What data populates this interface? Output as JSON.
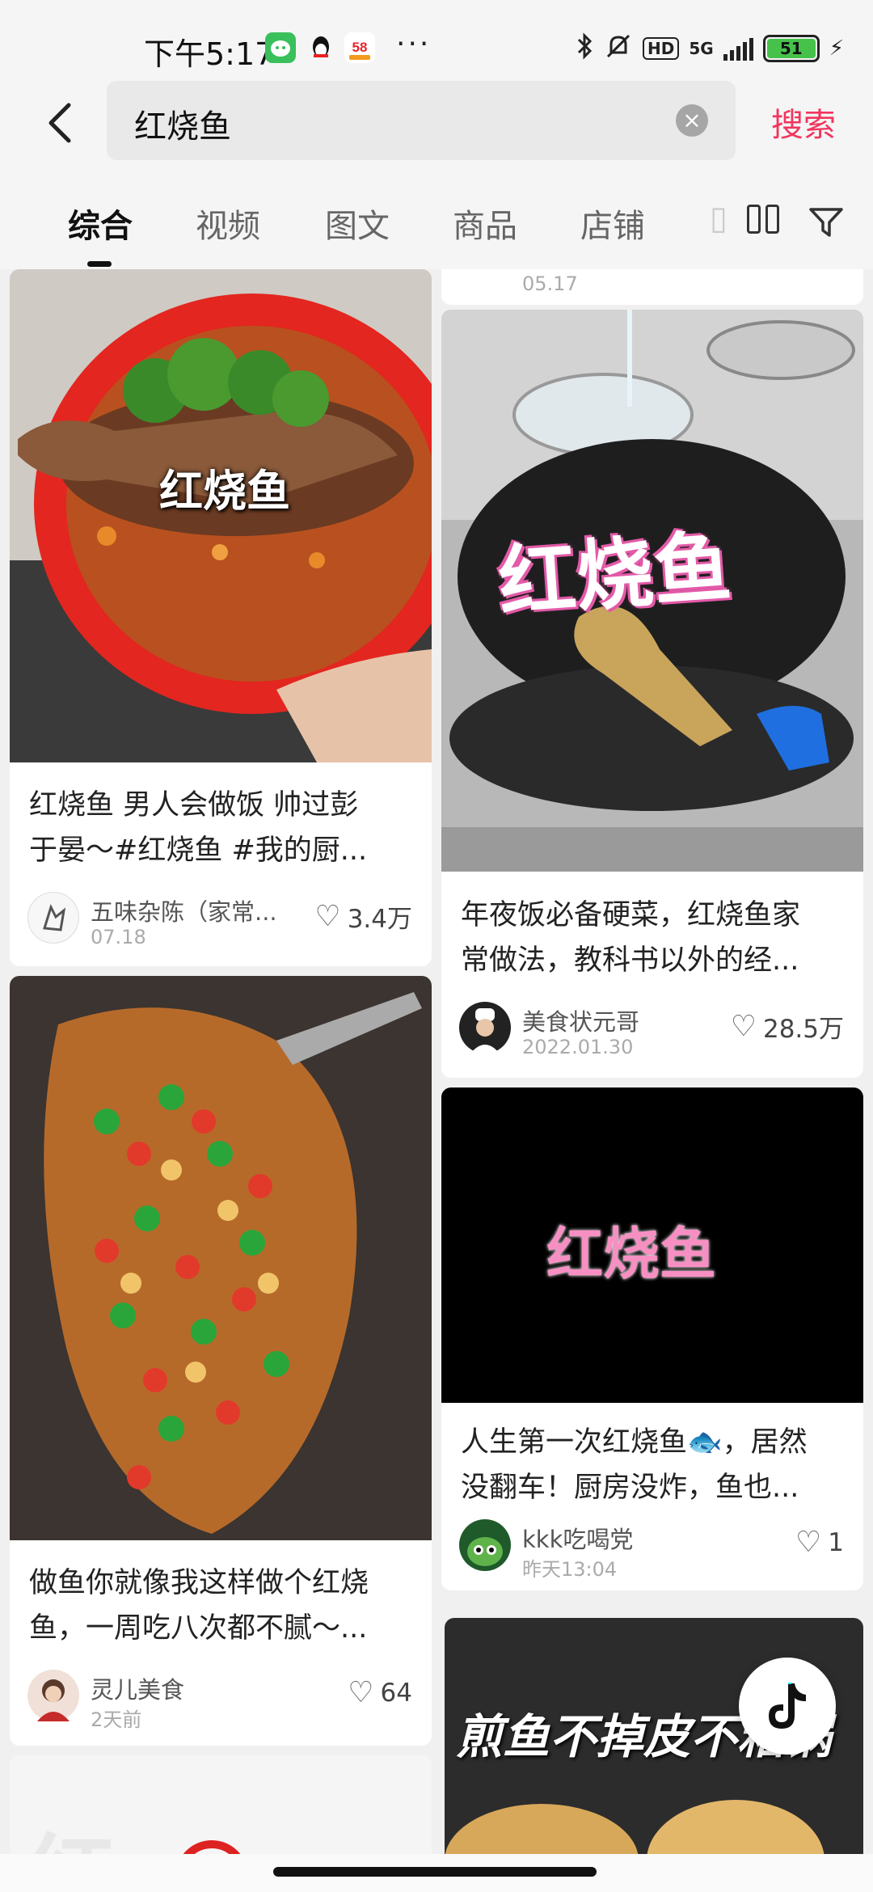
{
  "status_bar": {
    "time": "下午5:17",
    "network": "5G",
    "hd": "HD",
    "battery": "51",
    "app_badge": "58"
  },
  "search": {
    "query": "红烧鱼",
    "submit_label": "搜索"
  },
  "tabs": [
    {
      "label": "综合",
      "active": true
    },
    {
      "label": "视频"
    },
    {
      "label": "图文"
    },
    {
      "label": "商品"
    },
    {
      "label": "店铺"
    }
  ],
  "partial_top_card": {
    "date": "05.17"
  },
  "cards": [
    {
      "overlay": "红烧鱼",
      "title_line1": "红烧鱼 男人会做饭 帅过彭",
      "title_line2": "于晏～#红烧鱼 #我的厨...",
      "author": "五味杂陈（家常...",
      "date": "07.18",
      "likes": "3.4万"
    },
    {
      "overlay": "红烧鱼",
      "title_line1": "年夜饭必备硬菜，红烧鱼家",
      "title_line2": "常做法，教科书以外的经...",
      "author": "美食状元哥",
      "date": "2022.01.30",
      "likes": "28.5万"
    },
    {
      "title_line1": "做鱼你就像我这样做个红烧",
      "title_line2": "鱼，一周吃八次都不腻～...",
      "author": "灵儿美食",
      "date": "2天前",
      "likes": "64"
    },
    {
      "overlay": "红烧鱼",
      "title_line1": "人生第一次红烧鱼🐟，居然",
      "title_line2": "没翻车！厨房没炸，鱼也...",
      "author": "kkk吃喝党",
      "date": "昨天13:04",
      "likes": "1"
    },
    {
      "overlay": "煎鱼不掉皮不粘锅"
    },
    {
      "overlay": "红"
    }
  ],
  "colors": {
    "accent": "#f0365e",
    "overlay_pink": "#f78fc2",
    "wechat_green": "#39c05b"
  },
  "icons": {
    "back": "back-arrow-icon",
    "clear": "clear-icon",
    "layout": "double-column-layout-icon",
    "filter": "filter-icon",
    "heart": "heart-icon",
    "float": "douyin-icon"
  }
}
